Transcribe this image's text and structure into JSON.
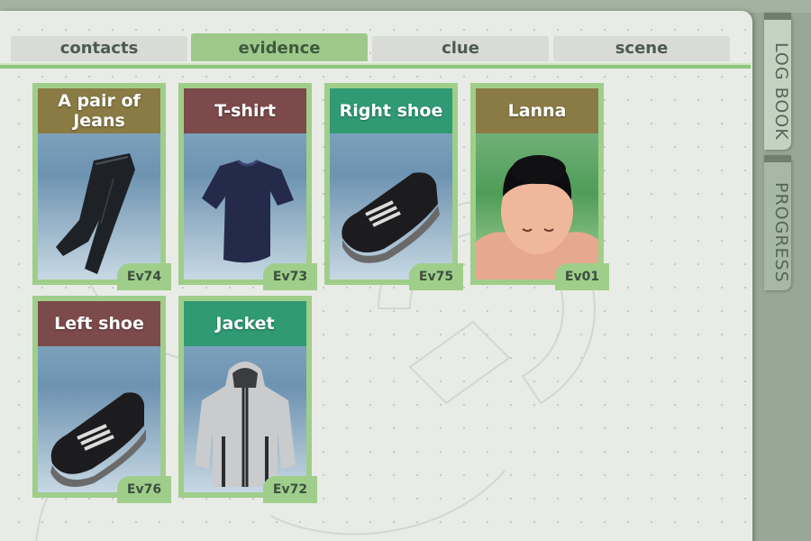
{
  "tabs": [
    {
      "label": "contacts",
      "active": false
    },
    {
      "label": "evidence",
      "active": true
    },
    {
      "label": "clue",
      "active": false
    },
    {
      "label": "scene",
      "active": false
    }
  ],
  "side_tabs": {
    "log_book": "LOG BOOK",
    "progress": "PROGRESS"
  },
  "evidence": [
    {
      "title": "A pair of Jeans",
      "code": "Ev74",
      "title_color": "#8a7a44",
      "item": "jeans"
    },
    {
      "title": "T-shirt",
      "code": "Ev73",
      "title_color": "#7c4a4a",
      "item": "t-shirt"
    },
    {
      "title": "Right shoe",
      "code": "Ev75",
      "title_color": "#2f9a74",
      "item": "shoe"
    },
    {
      "title": "Lanna",
      "code": "Ev01",
      "title_color": "#8a7a44",
      "item": "person"
    },
    {
      "title": "Left shoe",
      "code": "Ev76",
      "title_color": "#7c4a4a",
      "item": "shoe"
    },
    {
      "title": "Jacket",
      "code": "Ev72",
      "title_color": "#2f9a74",
      "item": "jacket"
    }
  ],
  "colors": {
    "active_tab": "#9ec98a",
    "card_frame": "#9fce8a",
    "panel": "#e9ebe6"
  }
}
